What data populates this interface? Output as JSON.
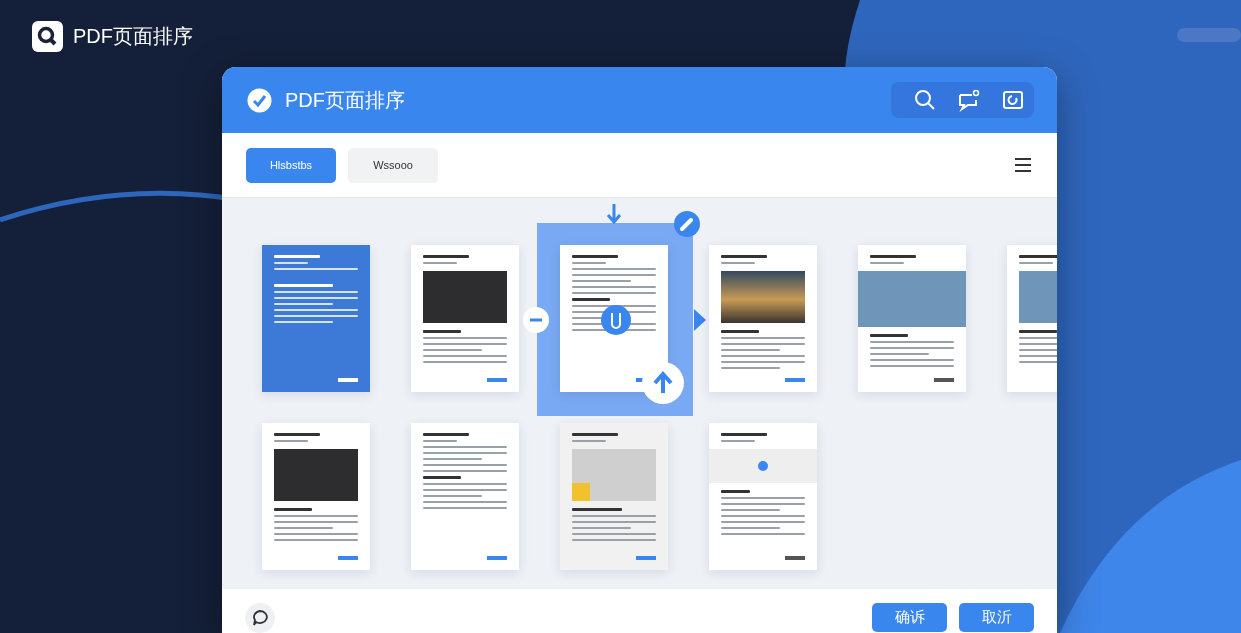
{
  "app": {
    "title": "PDF页面排序"
  },
  "window": {
    "title": "PDF页面排序"
  },
  "tabs": [
    {
      "label": "Hlsbstbs",
      "selected": true
    },
    {
      "label": "Wssooo",
      "selected": false
    }
  ],
  "pages": [
    {
      "kind": "cover",
      "selected": false
    },
    {
      "kind": "dark-image",
      "selected": false
    },
    {
      "kind": "text",
      "selected": true
    },
    {
      "kind": "sunset-image",
      "selected": false
    },
    {
      "kind": "banner",
      "selected": false
    },
    {
      "kind": "side-image",
      "selected": false
    },
    {
      "kind": "dark-image",
      "selected": false
    },
    {
      "kind": "text",
      "selected": false
    },
    {
      "kind": "gray-image",
      "selected": false
    },
    {
      "kind": "icon-card",
      "selected": false
    }
  ],
  "footer": {
    "buttons": [
      {
        "label": "确诉"
      },
      {
        "label": "取沂"
      }
    ]
  }
}
